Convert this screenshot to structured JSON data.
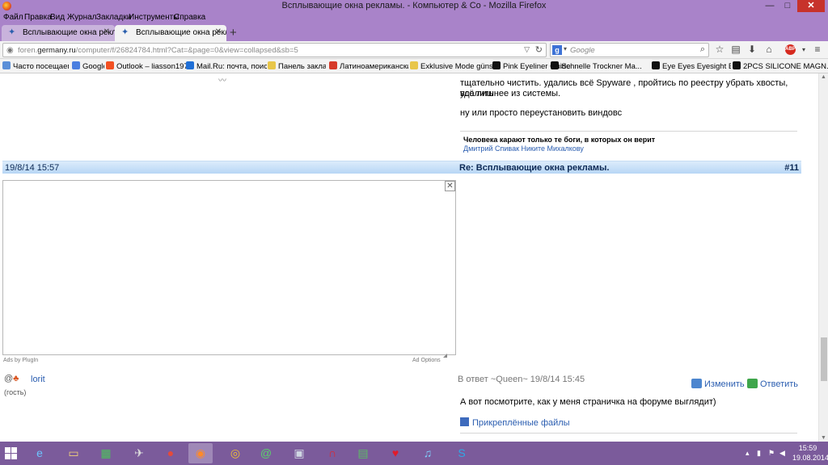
{
  "window": {
    "title": "Всплывающие окна рекламы. - Компьютер & Co - Mozilla Firefox",
    "minimize": "—",
    "maximize": "□",
    "close": "✕"
  },
  "menu": [
    "Файл",
    "Правка",
    "Вид",
    "Журнал",
    "Закладки",
    "Инструменты",
    "Справка"
  ],
  "tabs": [
    {
      "label": "Всплывающие окна рекл...",
      "active": false
    },
    {
      "label": "Всплывающие окна рекл...",
      "active": true
    }
  ],
  "newtab": "+",
  "tab_close": "✕",
  "address": {
    "prefix": "foren.",
    "domain": "germany.ru",
    "path": "/computer/f/26824784.html?Cat=&page=0&view=collapsed&sb=5"
  },
  "search": {
    "placeholder": "Google"
  },
  "bookmarks": [
    {
      "label": "Часто посещаемые",
      "color": "#5a8fd8"
    },
    {
      "label": "Google",
      "color": "#4a7fe0"
    },
    {
      "label": "Outlook – liasson197...",
      "color": "#f25022"
    },
    {
      "label": "Mail.Ru: почта, поиск ...",
      "color": "#1f6fd6"
    },
    {
      "label": "Панель закладок",
      "color": "#e8c64a"
    },
    {
      "label": "Латиноамериканские...",
      "color": "#d63a2a"
    },
    {
      "label": "Exklusive Mode günsti...",
      "color": "#e8c64a"
    },
    {
      "label": "Pink Eyeliner Guide Pe...",
      "color": "#111111"
    },
    {
      "label": "Schnelle Trockner Ma...",
      "color": "#111111"
    },
    {
      "label": "Eye Eyes Eyesight Exer...",
      "color": "#111111"
    },
    {
      "label": "2PCS SILICONE MAGN...",
      "color": "#111111"
    }
  ],
  "post_prev": {
    "line1": "тщательно чистить. удались всё Spyware , пройтись по реестру убрать хвосты, удалить",
    "line2": "всё лишнее из системы.",
    "line3": "ну или просто переустановить виндовс",
    "signature_bold": "Человека карают только те боги, в которых он верит",
    "signature_link": "Дмитрий Спивак Никите Михалкову"
  },
  "post": {
    "date": "19/8/14 15:57",
    "subject": "Re: Всплывающие окна рекламы.",
    "number": "#11",
    "ads_by": "Ads by PlugIn",
    "ad_options": "Ad Options",
    "ad_close": "✕",
    "user": "lorit",
    "guest": "(гость)",
    "reply_to": "В ответ ~Queen~ 19/8/14 15:45",
    "edit": "Изменить",
    "reply": "Ответить",
    "message": "А вот посмотрите, как у меня страничка на форуме выглядит)",
    "attachments": "Прикреплённые файлы"
  },
  "clock": {
    "time": "15:59",
    "date": "19.08.2014"
  }
}
